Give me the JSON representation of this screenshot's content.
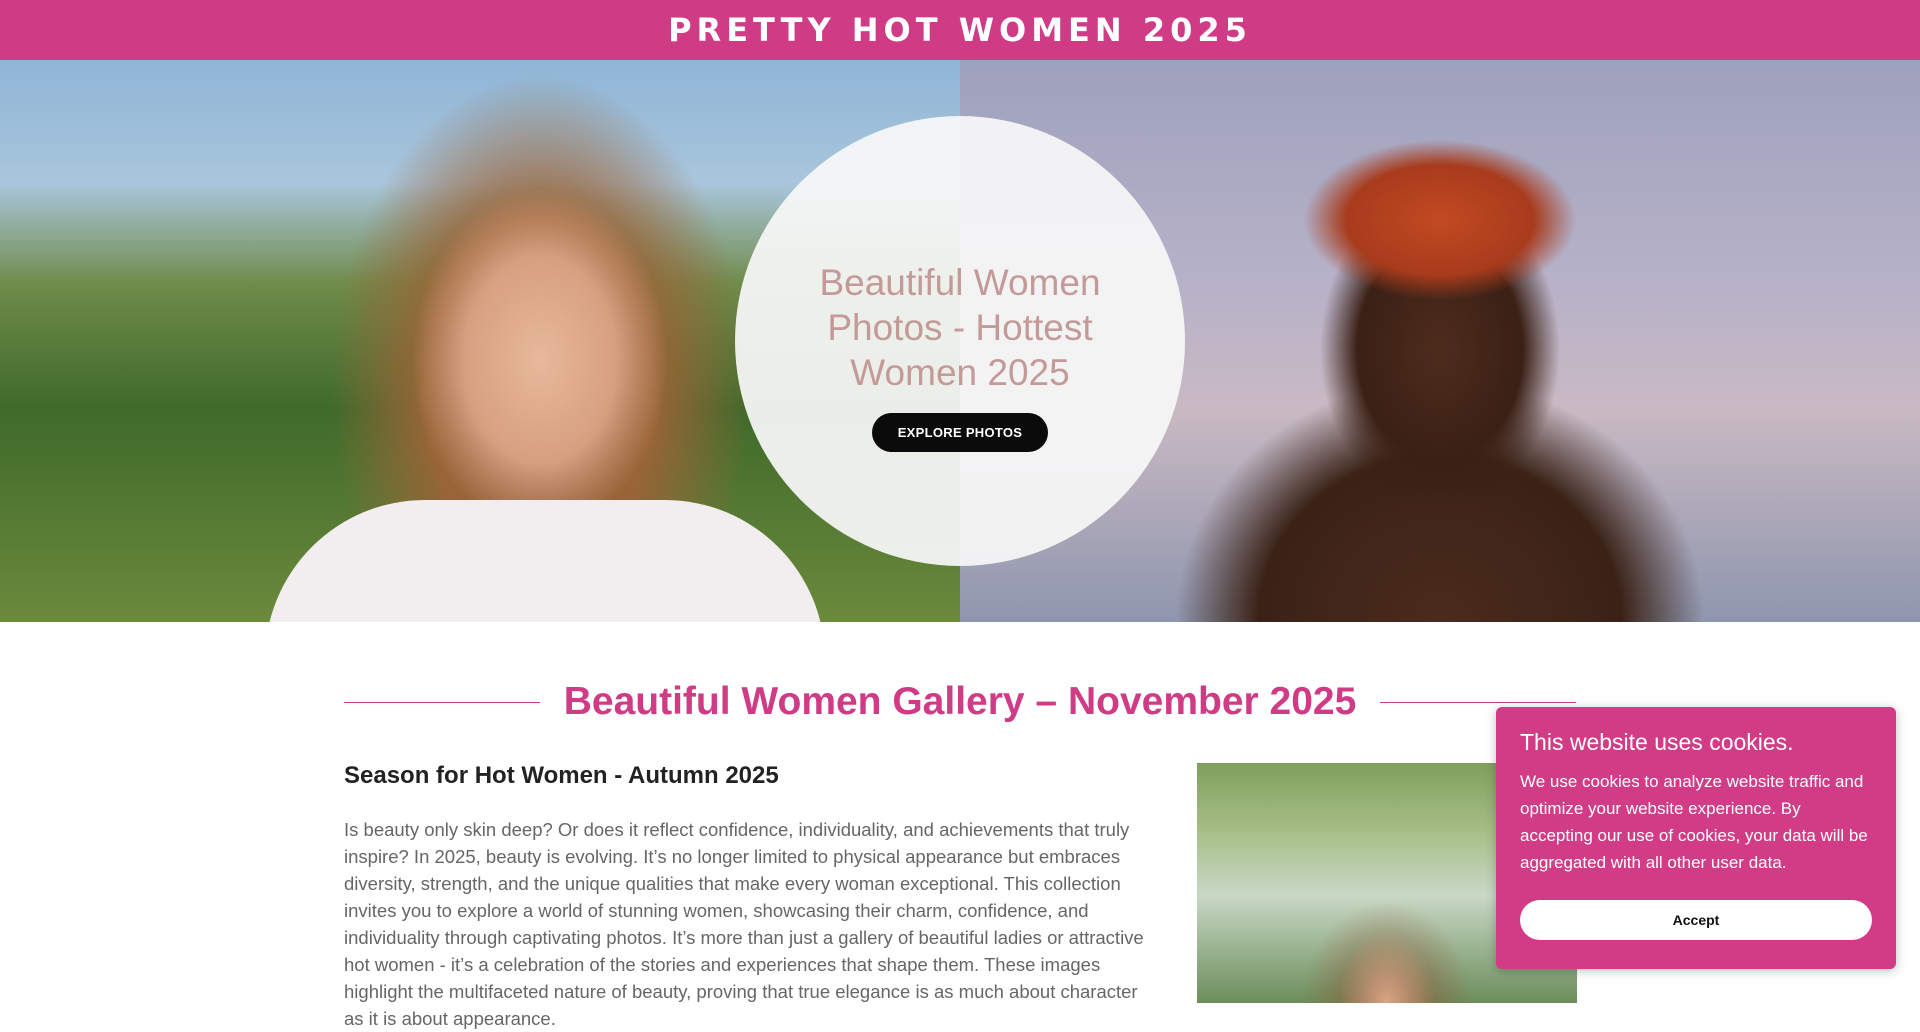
{
  "header": {
    "site_title": "PRETTY HOT WOMEN 2025"
  },
  "hero": {
    "heading": "Beautiful Women Photos - Hottest Women 2025",
    "cta_label": "EXPLORE PHOTOS"
  },
  "gallery": {
    "heading": "Beautiful Women Gallery – November 2025",
    "subheading": "Season for Hot Women - Autumn 2025",
    "body": "Is beauty only skin deep? Or does it reflect confidence, individuality, and achievements that truly inspire? In 2025, beauty is evolving. It’s no longer limited to physical appearance but embraces diversity, strength, and the unique qualities that make every woman exceptional. This collection invites you to explore a world of stunning women, showcasing their charm, confidence, and individuality through captivating photos. It’s more than just a gallery of beautiful ladies or attractive hot women - it’s a celebration of the stories and experiences that shape them. These images highlight the multifaceted nature of beauty, proving that true elegance is as much about character as it is about appearance."
  },
  "cookie_banner": {
    "title": "This website uses cookies.",
    "text": "We use cookies to analyze website traffic and optimize your website experience. By accepting our use of cookies, your data will be aggregated with all other user data.",
    "accept_label": "Accept"
  },
  "colors": {
    "brand_pink": "#cf3b85",
    "cookie_bg": "#d23c86",
    "hero_heading": "#c49a98",
    "button_dark": "#0b0b0b"
  }
}
